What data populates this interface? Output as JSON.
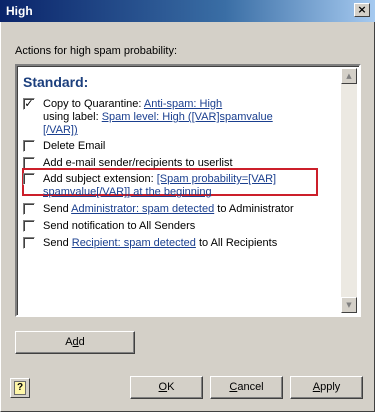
{
  "window": {
    "title": "High",
    "close_glyph": "×"
  },
  "actions_label": "Actions for high spam probability:",
  "section": "Standard:",
  "items": [
    {
      "checked": true,
      "parts": [
        {
          "t": "Copy to Quarantine: "
        },
        {
          "t": "Anti-spam: High",
          "link": true
        }
      ],
      "line2": [
        {
          "t": "using label: "
        },
        {
          "t": "Spam level: High ([VAR]spamvalue",
          "link": true
        }
      ],
      "line3": [
        {
          "t": "[/VAR])",
          "link": true
        }
      ]
    },
    {
      "checked": false,
      "text": "Delete Email"
    },
    {
      "checked": false,
      "text": "Add e-mail sender/recipients to userlist"
    },
    {
      "checked": false,
      "prefix": "Add subject extension: ",
      "link1": "[Spam probability=[VAR]",
      "link2": "spamvalue[/VAR]] at the beginning"
    },
    {
      "checked": false,
      "prefix": "Send ",
      "link": "Administrator: spam detected",
      "suffix": " to Administrator"
    },
    {
      "checked": false,
      "text": "Send notification to All Senders"
    },
    {
      "checked": false,
      "prefix": "Send ",
      "link": "Recipient: spam detected",
      "suffix": " to All Recipients"
    }
  ],
  "buttons": {
    "add_pre": "A",
    "add_ul": "d",
    "add_post": "d",
    "ok_ul": "O",
    "ok_post": "K",
    "cancel_ul": "C",
    "cancel_post": "ancel",
    "apply_ul": "A",
    "apply_post": "pply"
  },
  "icons": {
    "close": "close-icon",
    "check": "checkmark-icon",
    "scroll_up": "scroll-up-arrow-icon",
    "scroll_down": "scroll-down-arrow-icon",
    "help": "help-book-icon"
  },
  "colors": {
    "link": "#1a3f8f",
    "section": "#1c3f7d",
    "highlight": "#cc1f2a",
    "title_start": "#0a246a"
  },
  "check_glyph": "✓",
  "help_glyph": "?",
  "up_glyph": "▲",
  "down_glyph": "▼"
}
